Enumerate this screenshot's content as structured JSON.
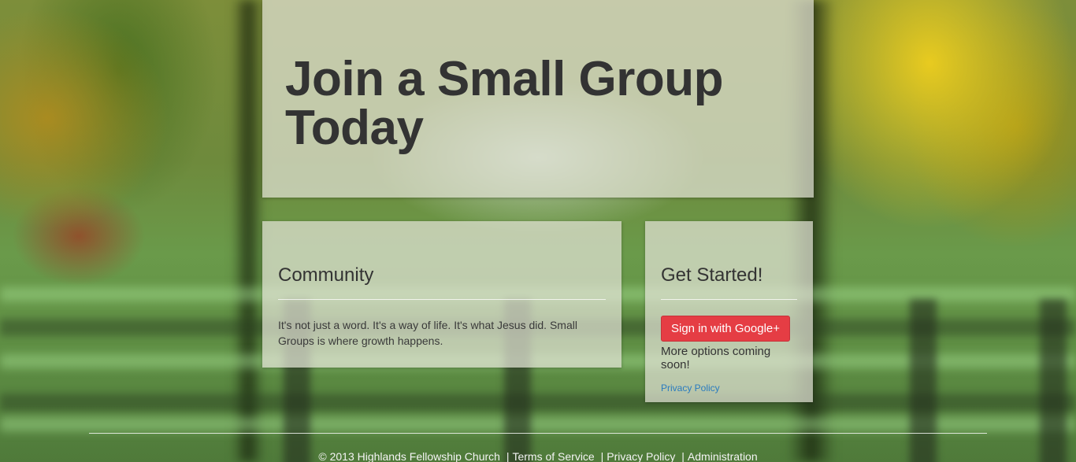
{
  "hero": {
    "title_line1": "Join a Small Group",
    "title_line2": "Today"
  },
  "community": {
    "heading": "Community",
    "body": "It's not just a word. It's a way of life. It's what Jesus did. Small Groups is where growth happens."
  },
  "get_started": {
    "heading": "Get Started!",
    "google_button": "Sign in with Google+",
    "more_options": "More options coming soon!",
    "privacy_link": "Privacy Policy"
  },
  "footer": {
    "copyright": "© 2013 Highlands Fellowship Church",
    "separator": "|",
    "terms": "Terms of Service",
    "privacy": "Privacy Policy",
    "admin": "Administration"
  },
  "colors": {
    "google_button": "#e53d44",
    "link": "#2a7bbf"
  }
}
